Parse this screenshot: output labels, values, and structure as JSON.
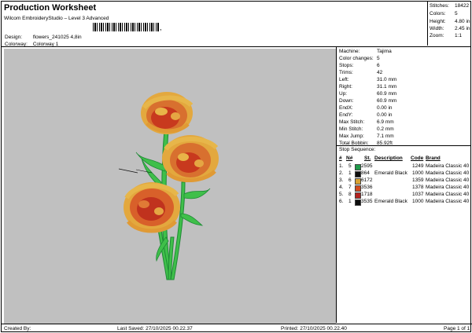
{
  "header": {
    "title": "Production Worksheet",
    "subtitle": "Wilcom EmbroideryStudio – Level 3 Advanced",
    "design_label": "Design:",
    "design_value": "flowers_241025 4,8in",
    "colorway_label": "Colorway:",
    "colorway_value": "Colorway 1"
  },
  "stats": [
    {
      "label": "Stitches:",
      "value": "18422"
    },
    {
      "label": "Colors:",
      "value": "5"
    },
    {
      "label": "Height:",
      "value": "4.80 in"
    },
    {
      "label": "Width:",
      "value": "2.45 in"
    },
    {
      "label": "Zoom:",
      "value": "1:1"
    }
  ],
  "machine_info": [
    {
      "label": "Machine:",
      "value": "Tajima"
    },
    {
      "label": "Color changes:",
      "value": "5"
    },
    {
      "label": "Stops:",
      "value": "6"
    },
    {
      "label": "Trims:",
      "value": "42"
    },
    {
      "label": "Left:",
      "value": "31.0 mm"
    },
    {
      "label": "Right:",
      "value": "31.1 mm"
    },
    {
      "label": "Up:",
      "value": "60.9 mm"
    },
    {
      "label": "Down:",
      "value": "60.9 mm"
    },
    {
      "label": "EndX:",
      "value": "0.00 in"
    },
    {
      "label": "EndY:",
      "value": "0.00 in"
    },
    {
      "label": "Max Stitch:",
      "value": "6.9 mm"
    },
    {
      "label": "Min Stitch:",
      "value": "0.2 mm"
    },
    {
      "label": "Max Jump:",
      "value": "7.1 mm"
    },
    {
      "label": "Total Bobbin:",
      "value": "85.92ft"
    }
  ],
  "stop_sequence": {
    "title": "Stop Sequence:",
    "headers": {
      "num": "#",
      "n": "N#",
      "st": "St.",
      "description": "Description",
      "code": "Code",
      "brand": "Brand"
    },
    "rows": [
      {
        "num": "1.",
        "n": "5",
        "color": "#1f9a4a",
        "st": "2595",
        "description": "",
        "code": "1249",
        "brand": "Madeira Classic 40"
      },
      {
        "num": "2.",
        "n": "1",
        "color": "#0d0d0d",
        "st": "864",
        "description": "Emerald Black",
        "code": "1000",
        "brand": "Madeira Classic 40"
      },
      {
        "num": "3.",
        "n": "6",
        "color": "#d9a232",
        "st": "6172",
        "description": "",
        "code": "1359",
        "brand": "Madeira Classic 40"
      },
      {
        "num": "4.",
        "n": "7",
        "color": "#d24a1e",
        "st": "3536",
        "description": "",
        "code": "1378",
        "brand": "Madeira Classic 40"
      },
      {
        "num": "5.",
        "n": "8",
        "color": "#b3221f",
        "st": "1718",
        "description": "",
        "code": "1037",
        "brand": "Madeira Classic 40"
      },
      {
        "num": "6.",
        "n": "1",
        "color": "#0d0d0d",
        "st": "3535",
        "description": "Emerald Black",
        "code": "1000",
        "brand": "Madeira Classic 40"
      }
    ]
  },
  "footer": {
    "created_by": "Created By:",
    "last_saved": "Last Saved: 27/10/2025 00.22.37",
    "printed": "Printed: 27/10/2025 00.22.40",
    "page": "Page 1 of 1"
  },
  "colors": {
    "design_bg": "#c0c0c0",
    "stem": "#3fbf4a",
    "petal_gold": "#e0a33a",
    "petal_orange": "#d8602a",
    "petal_red": "#c0321e"
  }
}
